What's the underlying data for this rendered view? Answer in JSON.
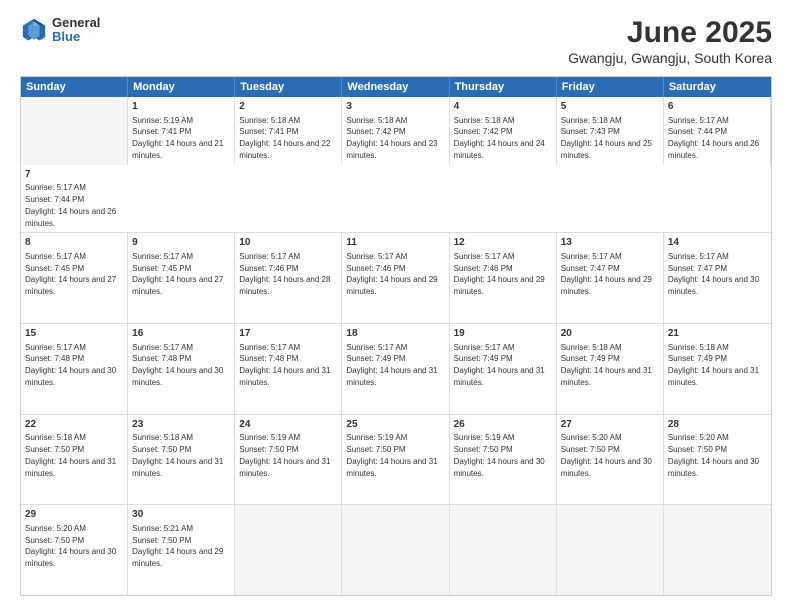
{
  "header": {
    "logo": {
      "general": "General",
      "blue": "Blue"
    },
    "title": "June 2025",
    "subtitle": "Gwangju, Gwangju, South Korea"
  },
  "calendar": {
    "headers": [
      "Sunday",
      "Monday",
      "Tuesday",
      "Wednesday",
      "Thursday",
      "Friday",
      "Saturday"
    ],
    "rows": [
      [
        {
          "day": "",
          "empty": true
        },
        {
          "day": "1",
          "rise": "5:19 AM",
          "set": "7:41 PM",
          "daylight": "14 hours and 21 minutes."
        },
        {
          "day": "2",
          "rise": "5:18 AM",
          "set": "7:41 PM",
          "daylight": "14 hours and 22 minutes."
        },
        {
          "day": "3",
          "rise": "5:18 AM",
          "set": "7:42 PM",
          "daylight": "14 hours and 23 minutes."
        },
        {
          "day": "4",
          "rise": "5:18 AM",
          "set": "7:42 PM",
          "daylight": "14 hours and 24 minutes."
        },
        {
          "day": "5",
          "rise": "5:18 AM",
          "set": "7:43 PM",
          "daylight": "14 hours and 25 minutes."
        },
        {
          "day": "6",
          "rise": "5:17 AM",
          "set": "7:44 PM",
          "daylight": "14 hours and 26 minutes."
        },
        {
          "day": "7",
          "rise": "5:17 AM",
          "set": "7:44 PM",
          "daylight": "14 hours and 26 minutes."
        }
      ],
      [
        {
          "day": "8",
          "rise": "5:17 AM",
          "set": "7:45 PM",
          "daylight": "14 hours and 27 minutes."
        },
        {
          "day": "9",
          "rise": "5:17 AM",
          "set": "7:45 PM",
          "daylight": "14 hours and 27 minutes."
        },
        {
          "day": "10",
          "rise": "5:17 AM",
          "set": "7:46 PM",
          "daylight": "14 hours and 28 minutes."
        },
        {
          "day": "11",
          "rise": "5:17 AM",
          "set": "7:46 PM",
          "daylight": "14 hours and 29 minutes."
        },
        {
          "day": "12",
          "rise": "5:17 AM",
          "set": "7:46 PM",
          "daylight": "14 hours and 29 minutes."
        },
        {
          "day": "13",
          "rise": "5:17 AM",
          "set": "7:47 PM",
          "daylight": "14 hours and 29 minutes."
        },
        {
          "day": "14",
          "rise": "5:17 AM",
          "set": "7:47 PM",
          "daylight": "14 hours and 30 minutes."
        }
      ],
      [
        {
          "day": "15",
          "rise": "5:17 AM",
          "set": "7:48 PM",
          "daylight": "14 hours and 30 minutes."
        },
        {
          "day": "16",
          "rise": "5:17 AM",
          "set": "7:48 PM",
          "daylight": "14 hours and 30 minutes."
        },
        {
          "day": "17",
          "rise": "5:17 AM",
          "set": "7:48 PM",
          "daylight": "14 hours and 31 minutes."
        },
        {
          "day": "18",
          "rise": "5:17 AM",
          "set": "7:49 PM",
          "daylight": "14 hours and 31 minutes."
        },
        {
          "day": "19",
          "rise": "5:17 AM",
          "set": "7:49 PM",
          "daylight": "14 hours and 31 minutes."
        },
        {
          "day": "20",
          "rise": "5:18 AM",
          "set": "7:49 PM",
          "daylight": "14 hours and 31 minutes."
        },
        {
          "day": "21",
          "rise": "5:18 AM",
          "set": "7:49 PM",
          "daylight": "14 hours and 31 minutes."
        }
      ],
      [
        {
          "day": "22",
          "rise": "5:18 AM",
          "set": "7:50 PM",
          "daylight": "14 hours and 31 minutes."
        },
        {
          "day": "23",
          "rise": "5:18 AM",
          "set": "7:50 PM",
          "daylight": "14 hours and 31 minutes."
        },
        {
          "day": "24",
          "rise": "5:19 AM",
          "set": "7:50 PM",
          "daylight": "14 hours and 31 minutes."
        },
        {
          "day": "25",
          "rise": "5:19 AM",
          "set": "7:50 PM",
          "daylight": "14 hours and 31 minutes."
        },
        {
          "day": "26",
          "rise": "5:19 AM",
          "set": "7:50 PM",
          "daylight": "14 hours and 30 minutes."
        },
        {
          "day": "27",
          "rise": "5:20 AM",
          "set": "7:50 PM",
          "daylight": "14 hours and 30 minutes."
        },
        {
          "day": "28",
          "rise": "5:20 AM",
          "set": "7:50 PM",
          "daylight": "14 hours and 30 minutes."
        }
      ],
      [
        {
          "day": "29",
          "rise": "5:20 AM",
          "set": "7:50 PM",
          "daylight": "14 hours and 30 minutes."
        },
        {
          "day": "30",
          "rise": "5:21 AM",
          "set": "7:50 PM",
          "daylight": "14 hours and 29 minutes."
        },
        {
          "day": "",
          "empty": true
        },
        {
          "day": "",
          "empty": true
        },
        {
          "day": "",
          "empty": true
        },
        {
          "day": "",
          "empty": true
        },
        {
          "day": "",
          "empty": true
        }
      ]
    ]
  }
}
